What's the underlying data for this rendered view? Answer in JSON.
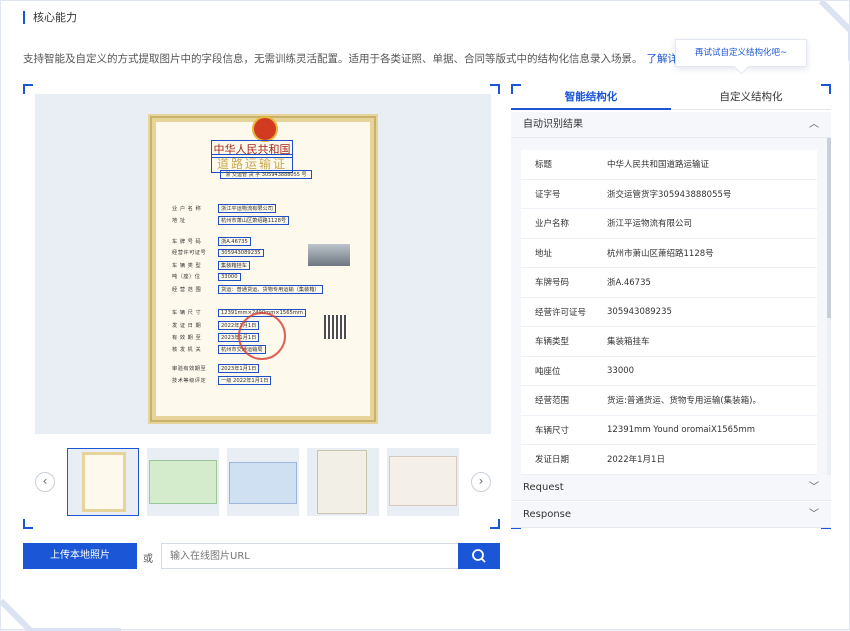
{
  "section": {
    "title": "核心能力",
    "desc": "支持智能及自定义的方式提取图片中的字段信息，无需训练灵活配置。适用于各类证照、单据、合同等版式中的结构化信息录入场景。",
    "link": "了解详情 ›",
    "tooltip": "再试试自定义结构化吧~"
  },
  "doc": {
    "title1": "中华人民共和国",
    "title2": "道路运输证",
    "sub": "浙 交运管 货 字 305943888055 号",
    "rows": [
      {
        "label": "业 户 名 称",
        "value": "浙江平运物流有限公司"
      },
      {
        "label": "地       址",
        "value": "杭州市萧山区萧绍路1128号"
      },
      {
        "label": "车 牌 号 码",
        "value": "浙A.46735"
      },
      {
        "label": "经营许可证号",
        "value": "305943089235"
      },
      {
        "label": "车 辆 类 型",
        "value": "集装箱挂车"
      },
      {
        "label": "吨（座）位",
        "value": "33000"
      },
      {
        "label": "经 营 范 围",
        "value": "货运：普通货运、货物专用运输（集装箱）"
      },
      {
        "label": "车 辆 尺 寸",
        "value": "12391mm×2490mm×1565mm"
      },
      {
        "label": "发 证 日 期",
        "value": "2022年1月1日"
      },
      {
        "label": "有 效 期 至",
        "value": "2023年1月1日"
      },
      {
        "label": "核 发 机 关",
        "value": "杭州市交通运输局"
      },
      {
        "label": "审验有效期至",
        "value": "2023年1月1日"
      },
      {
        "label": "技术等级评定",
        "value": "一级  2022年1月1日"
      }
    ]
  },
  "upload": {
    "button": "上传本地照片",
    "or": "或",
    "placeholder": "输入在线图片URL"
  },
  "tabs": [
    "智能结构化",
    "自定义结构化"
  ],
  "accordion": {
    "result_title": "自动识别结果",
    "request": "Request",
    "response": "Response"
  },
  "results": [
    {
      "key": "标题",
      "value": "中华人民共和国道路运输证"
    },
    {
      "key": "证字号",
      "value": "浙交运管货字305943888055号"
    },
    {
      "key": "业户名称",
      "value": "浙江平运物流有限公司"
    },
    {
      "key": "地址",
      "value": "杭州市萧山区萧绍路1128号"
    },
    {
      "key": "车牌号码",
      "value": "浙A.46735"
    },
    {
      "key": "经营许可证号",
      "value": "305943089235"
    },
    {
      "key": "车辆类型",
      "value": "集装箱挂车"
    },
    {
      "key": "吨座位",
      "value": "33000"
    },
    {
      "key": "经营范围",
      "value": "货运:普通货运、货物专用运输(集装箱)。"
    },
    {
      "key": "车辆尺寸",
      "value": "12391mm Yound oromaiX1565mm"
    },
    {
      "key": "发证日期",
      "value": "2022年1月1日"
    }
  ],
  "colors": {
    "accent": "#1a56d6"
  }
}
